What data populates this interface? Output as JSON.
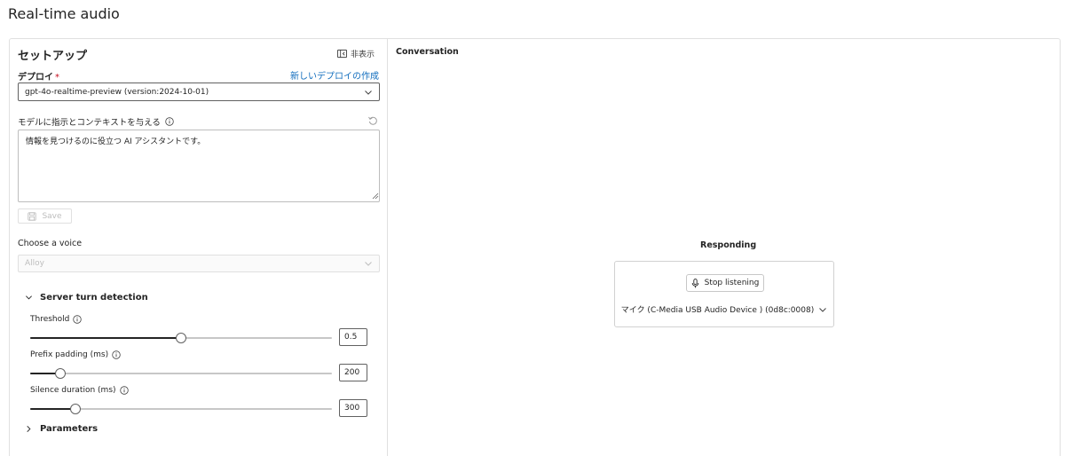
{
  "page": {
    "title": "Real-time audio"
  },
  "setup": {
    "title": "セットアップ",
    "hide_label": "非表示",
    "deployment": {
      "label": "デプロイ",
      "required_mark": "*",
      "new_link": "新しいデプロイの作成",
      "selected": "gpt-4o-realtime-preview (version:2024-10-01)"
    },
    "instructions": {
      "label": "モデルに指示とコンテキストを与える",
      "value": "情報を見つけるのに役立つ AI アシスタントです。"
    },
    "save_label": "Save",
    "voice": {
      "label": "Choose a voice",
      "selected": "Alloy"
    },
    "server_turn_detection": {
      "title": "Server turn detection",
      "threshold": {
        "label": "Threshold",
        "value": "0.5",
        "fraction": 0.5
      },
      "prefix_padding": {
        "label": "Prefix padding (ms)",
        "value": "200",
        "fraction": 0.1
      },
      "silence_duration": {
        "label": "Silence duration (ms)",
        "value": "300",
        "fraction": 0.15
      }
    },
    "parameters": {
      "title": "Parameters"
    }
  },
  "conversation": {
    "title": "Conversation",
    "status": "Responding",
    "stop_label": "Stop listening",
    "device": "マイク (C-Media USB Audio Device ) (0d8c:0008)"
  }
}
